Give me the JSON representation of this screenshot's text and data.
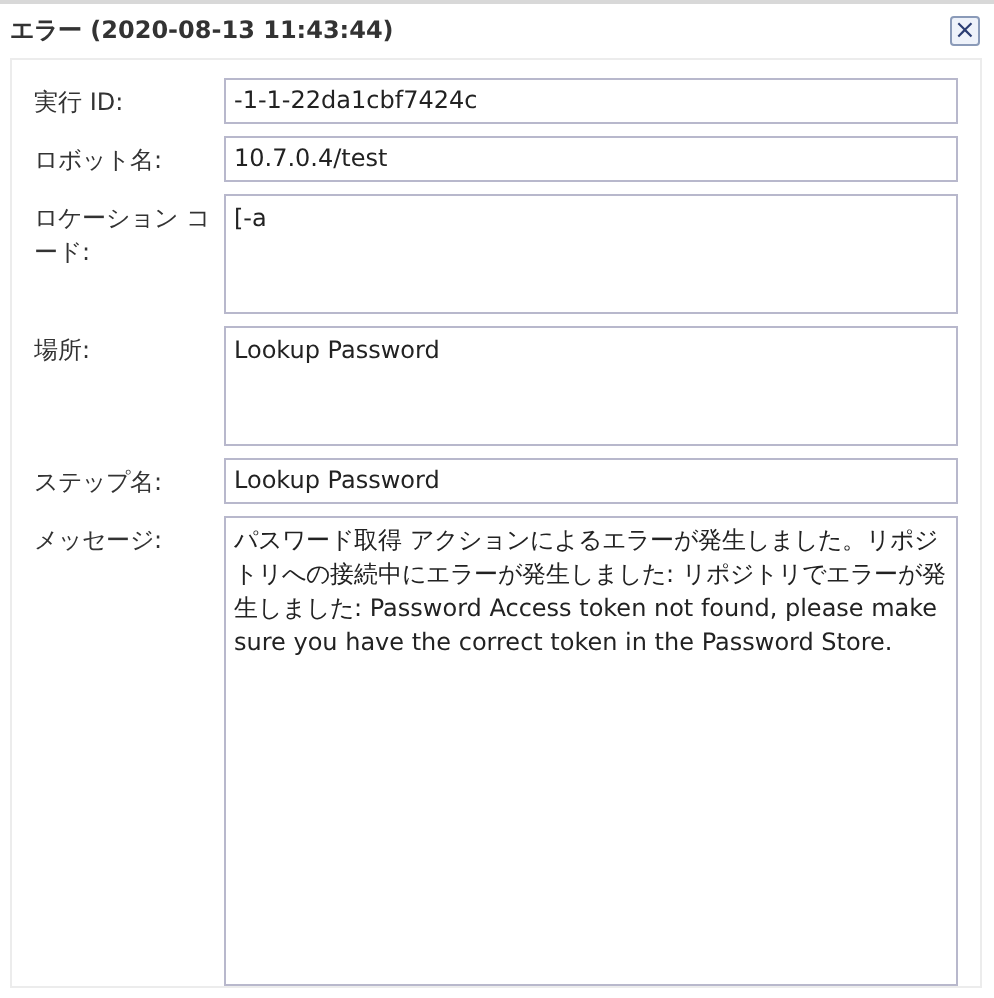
{
  "dialog": {
    "title": "エラー (2020-08-13 11:43:44)",
    "close": "×"
  },
  "fields": [
    {
      "label": "実行 ID:",
      "value": "-1-1-22da1cbf7424c",
      "kind": "single"
    },
    {
      "label": "ロボット名:",
      "value": "10.7.0.4/test",
      "kind": "single"
    },
    {
      "label": "ロケーション コード:",
      "value": "[-a",
      "kind": "multi"
    },
    {
      "label": "場所:",
      "value": "Lookup Password",
      "kind": "multi"
    },
    {
      "label": "ステップ名:",
      "value": "Lookup Password",
      "kind": "single"
    },
    {
      "label": "メッセージ:",
      "value": "パスワード取得 アクションによるエラーが発生しました。リポジトリへの接続中にエラーが発生しました: リポジトリでエラーが発生しました: Password Access token not found, please make sure you have the correct token in the Password Store.",
      "kind": "message"
    }
  ]
}
